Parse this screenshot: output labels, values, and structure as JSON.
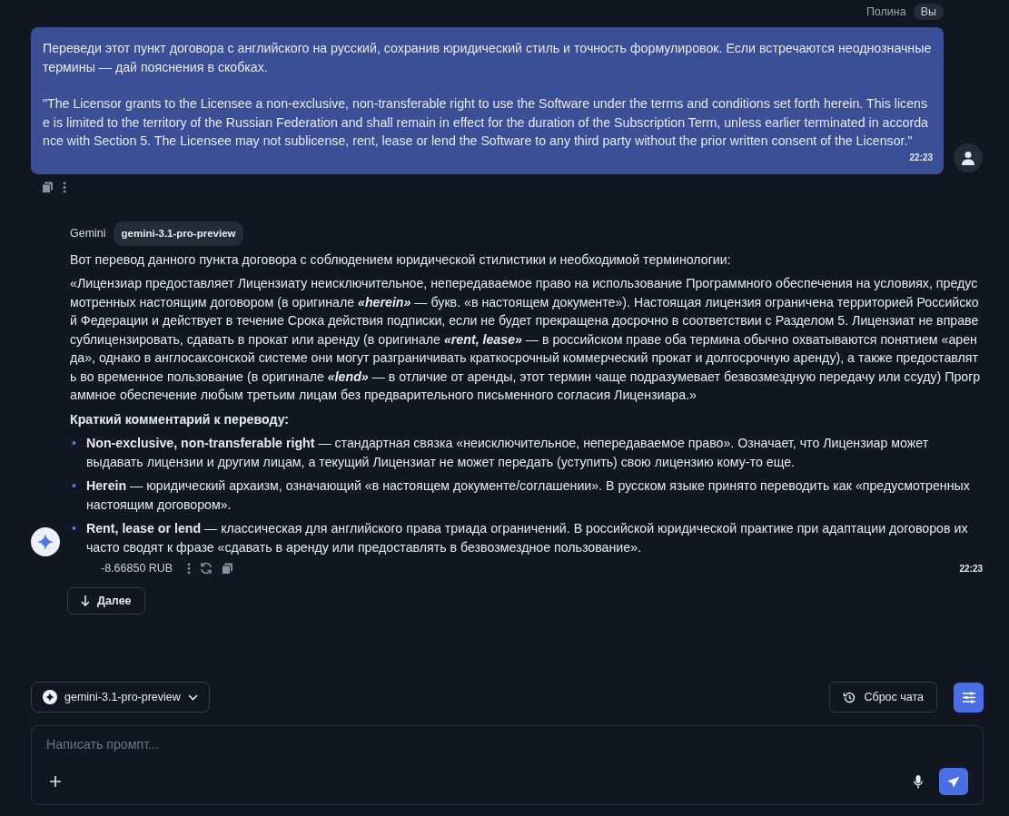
{
  "user_message": {
    "author": "Полина",
    "badge": "Вы",
    "paragraphs": [
      "Переведи этот пункт договора с английского на русский, сохранив юридический стиль и точность формулировок. Если встречаются неоднозначные термины — дай пояснения в скобках.",
      "\"The Licensor grants to the Licensee a non-exclusive, non-transferable right to use the Software under the terms and conditions set forth herein. This license is limited to the territory of the Russian Federation and shall remain in effect for the duration of the Subscription Term, unless earlier terminated in accordance with Section 5. The Licensee may not sublicense, rent, lease or lend the Software to any third party without the prior written consent of the Licensor.\""
    ],
    "time": "22:23"
  },
  "assistant_message": {
    "author": "Gemini",
    "model": "gemini-3.1-pro-preview",
    "intro": "Вот перевод данного пункта договора с соблюдением юридической стилистики и необходимой терминологии:",
    "translation": "«Лицензиар предоставляет Лицензиату неисключительное, непередаваемое право на использование Программного обеспечения на условиях, предусмотренных настоящим договором (в оригинале **«herein»** — букв. «в настоящем документе»). Настоящая лицензия ограничена территорией Российской Федерации и действует в течение Срока действия подписки, если не будет прекращена досрочно в соответствии с Разделом 5. Лицензиат не вправе сублицензировать, сдавать в прокат или аренду (в оригинале **«rent, lease»** — в российском праве оба термина обычно охватываются понятием «аренда», однако в англосаксонской системе они могут разграничивать краткосрочный коммерческий прокат и долгосрочную аренду), а также предоставлять во временное пользование (в оригинале **«lend»** — в отличие от аренды, этот термин чаще подразумевает безвозмездную передачу или ссуду) Программное обеспечение любым третьим лицам без предварительного письменного согласия Лицензиара.»",
    "comment_heading": "Краткий комментарий к переводу:",
    "bullets": [
      {
        "marker": "•",
        "text": "**Non-exclusive, non-transferable right** — стандартная связка «неисключительное, непередаваемое право». Означает, что Лицензиар может выдавать лицензии и другим лицам, а текущий Лицензиат не может передать (уступить) свою лицензию кому-то еще."
      },
      {
        "marker": "•",
        "text": "**Herein** — юридический архаизм, означающий «в настоящем документе/соглашении». В русском языке принято переводить как «предусмотренных настоящим договором»."
      },
      {
        "marker": "•",
        "text": "**Rent, lease or lend** — классическая для английского права триада ограничений. В российской юридической практике при адаптации договоров их часто сводят к фразе «сдавать в аренду или предоставлять в безвозмездное пользование»."
      }
    ],
    "cost": "-8.66850 RUB",
    "time": "22:23"
  },
  "more_button": {
    "label": "Далее"
  },
  "composer": {
    "model": "gemini-3.1-pro-preview",
    "reset_label": "Сброс чата",
    "placeholder": "Написать промпт..."
  }
}
